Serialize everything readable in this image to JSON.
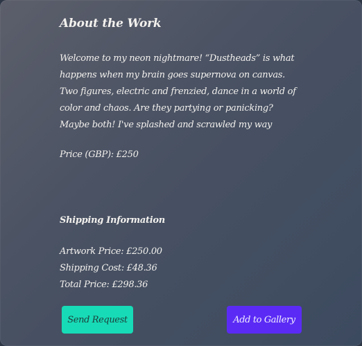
{
  "about": {
    "title": "About the Work",
    "description": "Welcome to my neon nightmare! “Dustheads” is what happens when my brain goes supernova on canvas. Two figures, electric and frenzied, dance in a world of color and chaos. Are they partying or panicking? Maybe both! I've splashed and scrawled my way through this urban fever dream, turning the canvas",
    "price": "Price (GBP): £250"
  },
  "shipping": {
    "title": "Shipping Information",
    "artwork_price": "Artwork Price: £250.00",
    "shipping_cost": "Shipping Cost: £48.36",
    "total_price": "Total Price: £298.36"
  },
  "actions": {
    "send_request": "Send Request",
    "add_to_gallery": "Add to Gallery"
  },
  "colors": {
    "send_button": "#17dbb6",
    "gallery_button": "#5b2bf5"
  }
}
